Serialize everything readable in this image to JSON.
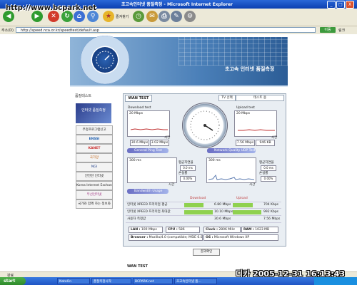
{
  "window": {
    "title": "초고속인터넷 품질측정 - Microsoft Internet Explorer",
    "min": "_",
    "max": "□",
    "close": "X"
  },
  "watermark": "http://www.bcpark.net",
  "toolbar": {
    "back_icon": "back-arrow-icon",
    "favorites_label": "즐겨찾기"
  },
  "address": {
    "label": "주소(D)",
    "url": "http://speed.nca.or.kr/speedtest/default.asp",
    "go": "이동",
    "links": "링크"
  },
  "banner": {
    "title": "초고속 인터넷 품질측정"
  },
  "section_title": "품질테스트",
  "sidebar": {
    "top": "인터넷 품질측정",
    "items": [
      "부정프로그램신고",
      "ENSSI",
      "KANET",
      "국가망",
      "NGI",
      "안전한 인터넷",
      "Korea Internet Exchange",
      "무선인터넷",
      "국가와 함께 하는 정보화"
    ]
  },
  "panel": {
    "tab": "WAN TEST",
    "tv_select": "TV 선택",
    "test_select": "테스트 용",
    "download": {
      "label": "Download test",
      "max": "20 Mbps",
      "time_label": "시간",
      "v1": "30.6 Mbps",
      "v2": "3.02 Mbps"
    },
    "upload": {
      "label": "Upload test",
      "max": "20 Mbps",
      "time_label": "시간",
      "v1": "7.56 Mbps",
      "v2": "946 KB"
    },
    "ping_general": {
      "title": "General Ping Test",
      "ms": "300 ms",
      "time_label": "시간",
      "avg_label": "평균지연율",
      "avg": "0.0 ms",
      "loss_label": "손실률",
      "loss": "0.00%"
    },
    "ping_network": {
      "title": "Network Quality UDP Test",
      "ms": "300 ms",
      "time_label": "시간",
      "avg_label": "평균지연율",
      "avg": "0.0 ms",
      "loss_label": "손실률",
      "loss": "0.00%"
    },
    "bandwidth_title": "Bandwidth Usage",
    "table": {
      "headers": [
        "",
        "Download",
        "Upload"
      ],
      "rows": [
        {
          "label": "인터넷 XPEED 프리미엄 평균",
          "down": "6.80 Mbps",
          "up": "704 Kbps",
          "down_frac": 0.68,
          "up_frac": 0.7
        },
        {
          "label": "인터넷 XPEED 프리미엄 최대값",
          "down": "10.10 Mbps",
          "up": "992 Kbps",
          "down_frac": 1.0,
          "up_frac": 0.99
        },
        {
          "label": "사용자 측정값",
          "down": "30.6 Mbps",
          "up": "7.56 Mbps",
          "down_frac": 0.0,
          "up_frac": 0.0
        }
      ]
    },
    "info": {
      "lan": "LAN :",
      "lan_val": "100 Mbps",
      "cpu": "CPU :",
      "cpu_val": "586",
      "clock": "Clock :",
      "clock_val": "2806 MHz",
      "ram": "RAM :",
      "ram_val": "1023 MB",
      "browser": "Browser :",
      "browser_val": "Mozilla/4.0 (compatible; MSIE 6.0",
      "os": "OS :",
      "os_val": "Microsoft Windows XP"
    },
    "result_button": "결과확인"
  },
  "wan_test_2": "WAN TEST",
  "status": "완료",
  "datestamp": "디카 2005-12-31 16:13:43",
  "taskbar": {
    "start": "start",
    "tasks": [
      "NateOn",
      "품질측정시작",
      "BCPARK.net",
      "초고속인터넷 품..."
    ]
  },
  "colors": {
    "titlebar": "#0b3fb0",
    "banner": "#4a7fb8",
    "bar": "#8fd14f",
    "panel": "#e9eef3"
  }
}
